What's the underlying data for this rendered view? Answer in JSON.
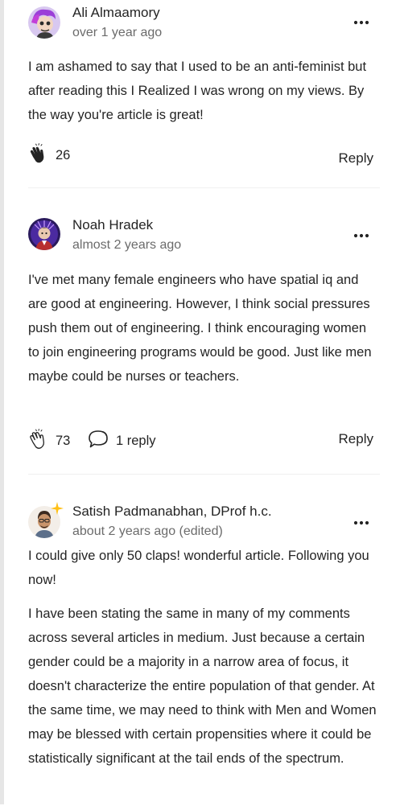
{
  "comments": [
    {
      "author": "Ali Almaamory",
      "time": "over 1 year ago",
      "paragraphs": [
        "I am ashamed to say that I used to be an anti-feminist but after reading this I Realized I was wrong on my views. By the way you're article is great!"
      ],
      "claps": "26",
      "reply_label": "Reply"
    },
    {
      "author": "Noah Hradek",
      "time": "almost 2 years ago",
      "paragraphs": [
        "I've met many female engineers who have spatial iq and are good at engineering. However, I think social pressures push them out of engineering. I think encouraging women to join engineering programs would be good. Just like men maybe could be nurses or teachers."
      ],
      "claps": "73",
      "replies": "1 reply",
      "reply_label": "Reply"
    },
    {
      "author": "Satish Padmanabhan, DProf h.c.",
      "time": "about 2 years ago (edited)",
      "paragraphs": [
        "I could give only 50 claps! wonderful article. Following you now!",
        "I have been stating the same in many of my comments across several articles in medium. Just because a certain gender could be a majority in a narrow area of focus, it doesn't characterize the entire population of that gender. At the same time, we may need to think with Men and Women may be blessed with certain propensities where it could be statistically significant at the tail ends of the spectrum."
      ]
    }
  ],
  "icons": {
    "more": "more-horizontal-icon",
    "clap": "clap-icon",
    "replies": "speech-bubble-icon",
    "badge": "sparkle-badge-icon"
  },
  "colors": {
    "text": "#242424",
    "meta": "#6b6b6b",
    "divider": "#f0f0f0",
    "badge": "#ffc017"
  }
}
